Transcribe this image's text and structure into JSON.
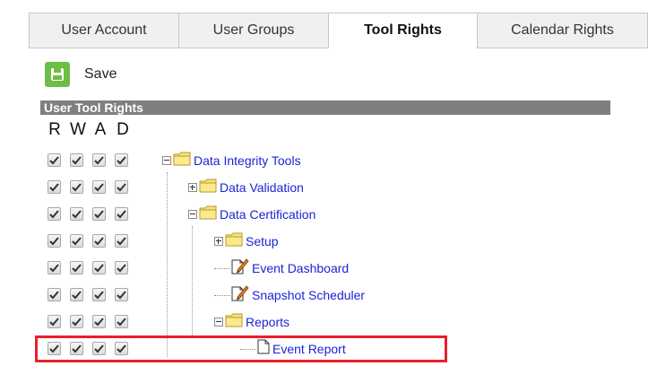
{
  "tabs": [
    {
      "label": "User Account",
      "active": false
    },
    {
      "label": "User Groups",
      "active": false
    },
    {
      "label": "Tool Rights",
      "active": true
    },
    {
      "label": "Calendar Rights",
      "active": false
    }
  ],
  "toolbar": {
    "save_label": "Save"
  },
  "section": {
    "title": "User Tool Rights"
  },
  "columns": {
    "r": "R",
    "w": "W",
    "a": "A",
    "d": "D"
  },
  "tree": [
    {
      "label": "Data Integrity Tools",
      "icon": "folder-icon",
      "expander": "minus",
      "checked": [
        true,
        true,
        true,
        true
      ]
    },
    {
      "label": "Data Validation",
      "icon": "folder-icon",
      "expander": "plus",
      "checked": [
        true,
        true,
        true,
        true
      ]
    },
    {
      "label": "Data Certification",
      "icon": "folder-icon",
      "expander": "minus",
      "checked": [
        true,
        true,
        true,
        true
      ]
    },
    {
      "label": "Setup",
      "icon": "folder-icon",
      "expander": "plus",
      "checked": [
        true,
        true,
        true,
        true
      ]
    },
    {
      "label": "Event Dashboard",
      "icon": "edit-page-icon",
      "expander": "none",
      "checked": [
        true,
        true,
        true,
        true
      ]
    },
    {
      "label": "Snapshot Scheduler",
      "icon": "edit-page-icon",
      "expander": "none",
      "checked": [
        true,
        true,
        true,
        true
      ]
    },
    {
      "label": "Reports",
      "icon": "folder-icon",
      "expander": "minus",
      "checked": [
        true,
        true,
        true,
        true
      ]
    },
    {
      "label": "Event Report",
      "icon": "page-icon",
      "expander": "none",
      "checked": [
        true,
        true,
        true,
        true
      ]
    }
  ],
  "colors": {
    "accent": "#6cbe45",
    "link": "#1c24d4",
    "highlight": "#e8202a",
    "header_bg": "#7f7f7f"
  }
}
